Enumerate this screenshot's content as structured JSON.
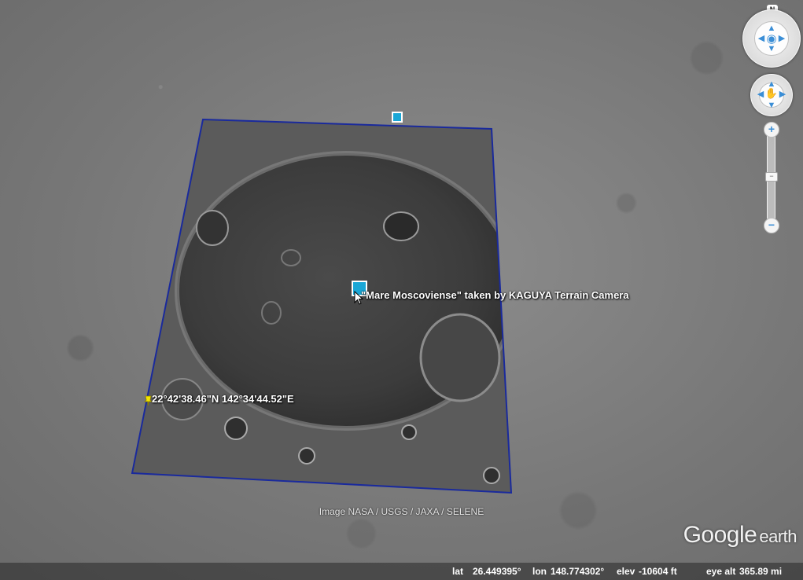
{
  "overlay": {
    "title": "\"Mare Moscoviense\" taken by KAGUYA Terrain Camera"
  },
  "placemark": {
    "coordinates": "22°42'38.46\"N 142°34'44.52\"E"
  },
  "attribution": "Image NASA / USGS / JAXA / SELENE",
  "brand": {
    "google": "Google",
    "earth": "earth"
  },
  "status": {
    "lat_label": "lat",
    "lat_value": "26.449395°",
    "lon_label": "lon",
    "lon_value": "148.774302°",
    "elev_label": "elev",
    "elev_value": "-10604 ft",
    "eyealt_label": "eye alt",
    "eyealt_value": "365.89 mi"
  },
  "nav": {
    "north_label": "N",
    "zoom_in": "+",
    "zoom_out": "−",
    "zoom_thumb": "−"
  },
  "colors": {
    "outline": "#1a2a9c",
    "handle": "#1aa7d6",
    "nav_accent": "#3a8ed6",
    "pin": "#f2e400"
  },
  "icons": {
    "look_center": "eye-icon",
    "move_center": "hand-icon",
    "placemark": "pushpin-icon",
    "pointer": "arrow-cursor-icon"
  }
}
